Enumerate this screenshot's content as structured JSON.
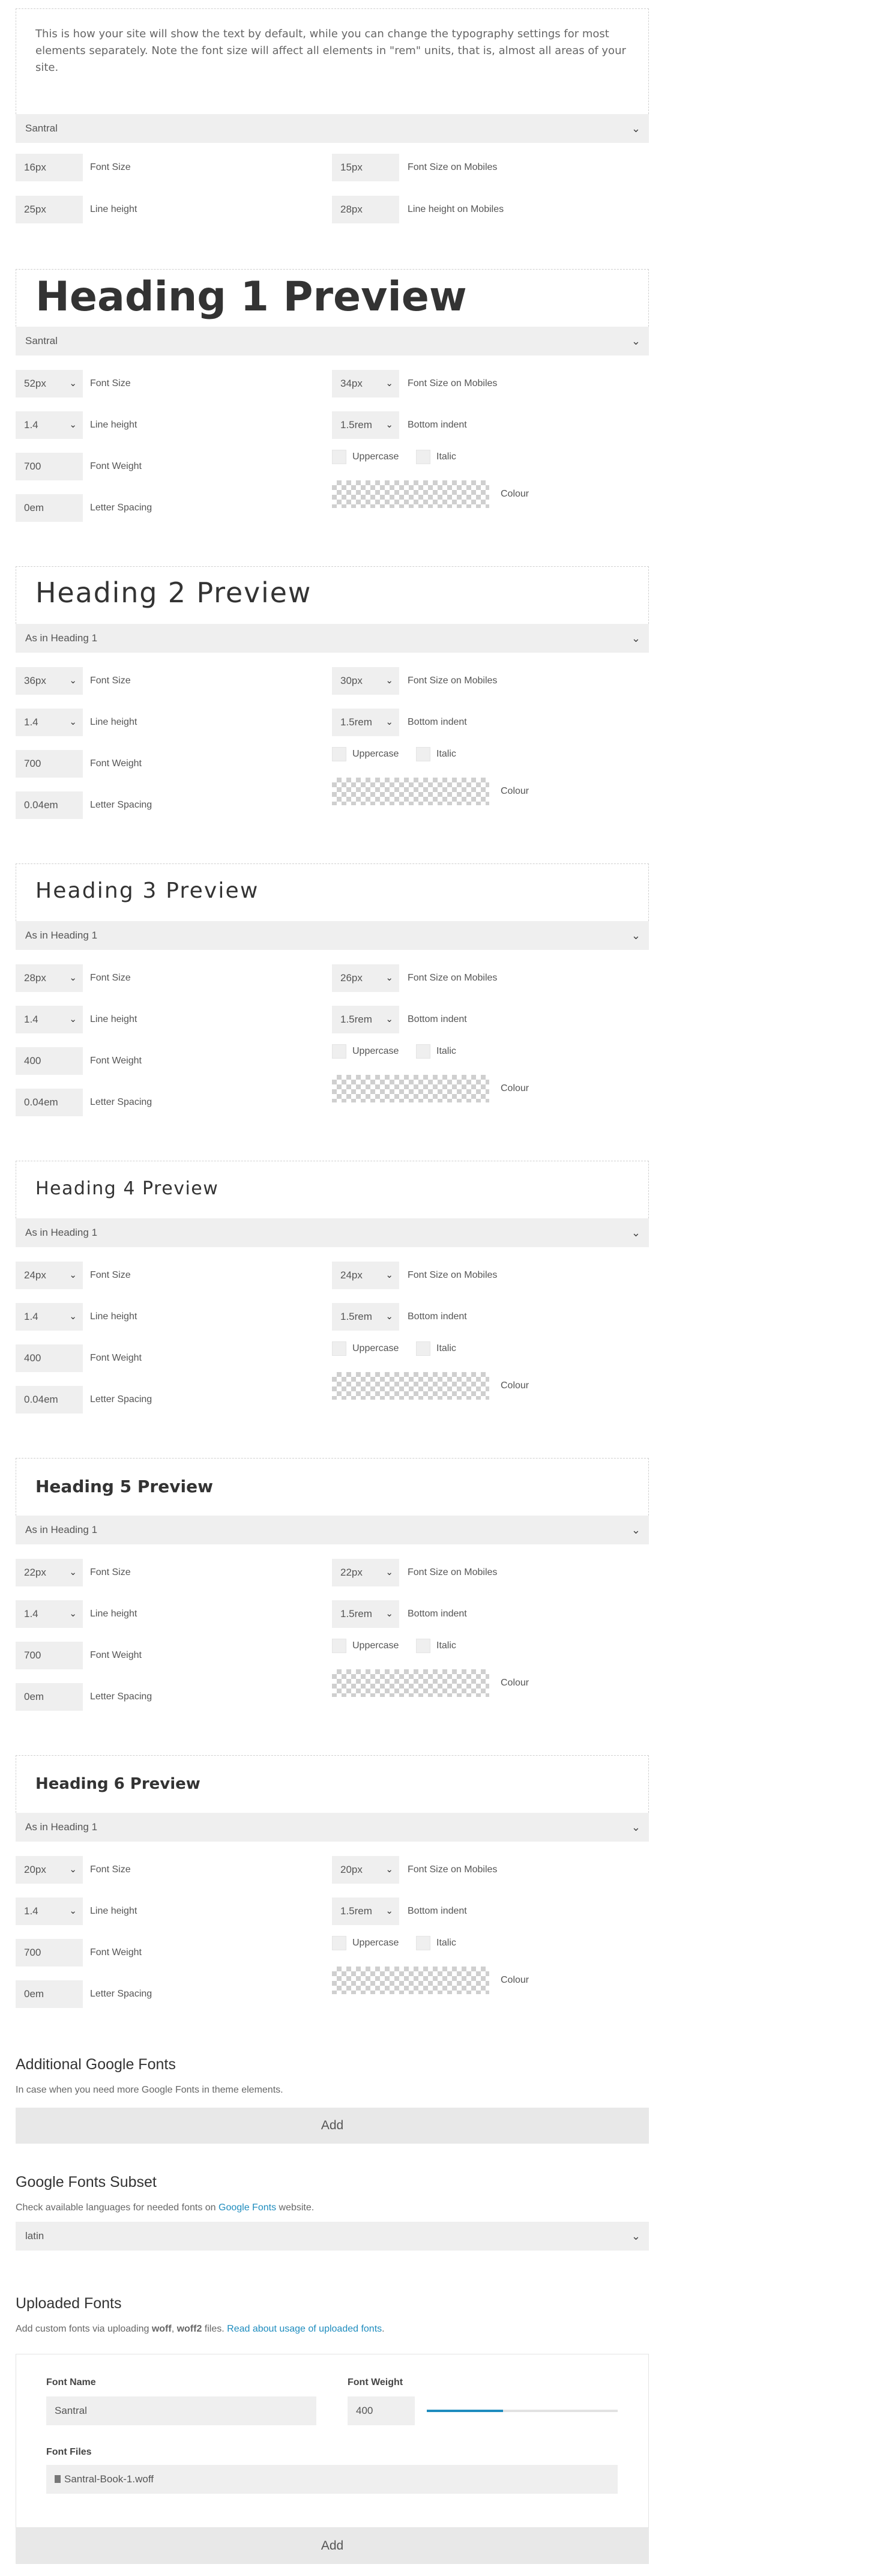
{
  "body_text": {
    "preview": "This is how your site will show the text by default, while you can change the typography settings for most elements separately. Note the font size will affect all elements in \"rem\" units, that is, almost all areas of your site.",
    "font": "Santral",
    "font_size": "16px",
    "font_size_label": "Font Size",
    "font_size_mobile": "15px",
    "font_size_mobile_label": "Font Size on Mobiles",
    "line_height": "25px",
    "line_height_label": "Line height",
    "line_height_mobile": "28px",
    "line_height_mobile_label": "Line height on Mobiles"
  },
  "headings": [
    {
      "preview": "Heading 1 Preview",
      "font": "Santral",
      "font_size": "52px",
      "font_size_mobile": "34px",
      "line_height": "1.4",
      "bottom_indent": "1.5rem",
      "font_weight": "700",
      "letter_spacing": "0em",
      "uppercase": false,
      "italic": false
    },
    {
      "preview": "Heading 2 Preview",
      "font": "As in Heading 1",
      "font_size": "36px",
      "font_size_mobile": "30px",
      "line_height": "1.4",
      "bottom_indent": "1.5rem",
      "font_weight": "700",
      "letter_spacing": "0.04em",
      "uppercase": false,
      "italic": false
    },
    {
      "preview": "Heading 3 Preview",
      "font": "As in Heading 1",
      "font_size": "28px",
      "font_size_mobile": "26px",
      "line_height": "1.4",
      "bottom_indent": "1.5rem",
      "font_weight": "400",
      "letter_spacing": "0.04em",
      "uppercase": false,
      "italic": false
    },
    {
      "preview": "Heading 4 Preview",
      "font": "As in Heading 1",
      "font_size": "24px",
      "font_size_mobile": "24px",
      "line_height": "1.4",
      "bottom_indent": "1.5rem",
      "font_weight": "400",
      "letter_spacing": "0.04em",
      "uppercase": false,
      "italic": false
    },
    {
      "preview": "Heading 5 Preview",
      "font": "As in Heading 1",
      "font_size": "22px",
      "font_size_mobile": "22px",
      "line_height": "1.4",
      "bottom_indent": "1.5rem",
      "font_weight": "700",
      "letter_spacing": "0em",
      "uppercase": false,
      "italic": false
    },
    {
      "preview": "Heading 6 Preview",
      "font": "As in Heading 1",
      "font_size": "20px",
      "font_size_mobile": "20px",
      "line_height": "1.4",
      "bottom_indent": "1.5rem",
      "font_weight": "700",
      "letter_spacing": "0em",
      "uppercase": false,
      "italic": false
    }
  ],
  "labels": {
    "font_size": "Font Size",
    "font_size_mobile": "Font Size on Mobiles",
    "line_height": "Line height",
    "bottom_indent": "Bottom indent",
    "font_weight": "Font Weight",
    "uppercase": "Uppercase",
    "italic": "Italic",
    "letter_spacing": "Letter Spacing",
    "colour": "Colour"
  },
  "google_fonts": {
    "title": "Additional Google Fonts",
    "desc": "In case when you need more Google Fonts in theme elements.",
    "add": "Add"
  },
  "subset": {
    "title": "Google Fonts Subset",
    "desc_before": "Check available languages for needed fonts on ",
    "desc_link": "Google Fonts",
    "desc_after": " website.",
    "value": "latin"
  },
  "uploaded": {
    "title": "Uploaded Fonts",
    "desc_1": "Add custom fonts via uploading ",
    "desc_b1": "woff",
    "desc_2": ", ",
    "desc_b2": "woff2",
    "desc_3": " files. ",
    "desc_link": "Read about usage of uploaded fonts",
    "desc_4": ".",
    "font_name_label": "Font Name",
    "font_name": "Santral",
    "font_weight_label": "Font Weight",
    "font_weight": "400",
    "font_weight_level": 0.4,
    "font_files_label": "Font Files",
    "font_file": "Santral-Book-1.woff",
    "add": "Add"
  },
  "colors": {
    "accent": "#1e8cbe",
    "field": "#efefef",
    "button": "#e8e8e8"
  }
}
